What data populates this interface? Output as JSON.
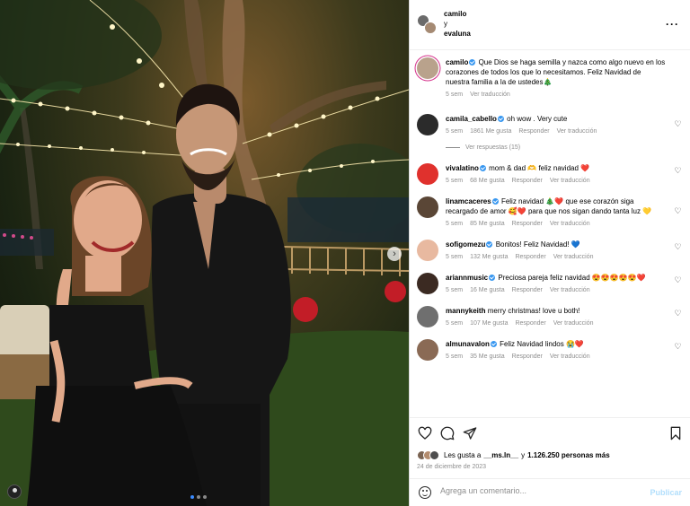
{
  "header": {
    "name1": "camilo",
    "conj": "y",
    "name2": "evaluna",
    "more": "···"
  },
  "caption": {
    "user": "camilo",
    "text": "Que Dios se haga semilla y nazca como algo nuevo en los corazones de todos los que lo necesitamos. Feliz Navidad de nuestra familia a la de ustedes🎄",
    "time": "5 sem",
    "translate": "Ver traducción"
  },
  "comments": [
    {
      "user": "camila_cabello",
      "text": "oh wow . Very cute",
      "time": "5 sem",
      "likes": "1861 Me gusta",
      "reply": "Responder",
      "translate": "Ver traducción",
      "avatar_color": "#2b2b2b"
    },
    {
      "user": "vivalatino",
      "text": "mom & dad 🫶 feliz navidad ❤️",
      "time": "5 sem",
      "likes": "68 Me gusta",
      "reply": "Responder",
      "translate": "Ver traducción",
      "avatar_color": "#e0312d"
    },
    {
      "user": "linamcaceres",
      "text": "Feliz navidad 🎄❤️ que ese corazón siga recargado de amor 🥰❤️ para que nos sigan dando tanta luz 💛",
      "time": "5 sem",
      "likes": "85 Me gusta",
      "reply": "Responder",
      "translate": "Ver traducción",
      "avatar_color": "#5a4636"
    },
    {
      "user": "sofigomezu",
      "text": "Bonitos! Feliz Navidad! 💙",
      "time": "5 sem",
      "likes": "132 Me gusta",
      "reply": "Responder",
      "translate": "Ver traducción",
      "avatar_color": "#e8b9a0"
    },
    {
      "user": "ariannmusic",
      "text": "Preciosa pareja feliz navidad 😍😍😍😍😍❤️",
      "time": "5 sem",
      "likes": "16 Me gusta",
      "reply": "Responder",
      "translate": "Ver traducción",
      "avatar_color": "#3b2a22"
    },
    {
      "user": "mannykeith",
      "text": "merry christmas! love u both!",
      "time": "5 sem",
      "likes": "107 Me gusta",
      "reply": "Responder",
      "translate": "Ver traducción",
      "avatar_color": "#6f6f6f"
    },
    {
      "user": "almunavalon",
      "text": "Feliz Navidad lindos 😭❤️",
      "time": "5 sem",
      "likes": "35 Me gusta",
      "reply": "Responder",
      "translate": "Ver traducción",
      "avatar_color": "#8a6a55"
    }
  ],
  "view_replies": "Ver respuestas (15)",
  "likes": {
    "prefix": "Les gusta a",
    "user": "__ms.ln__",
    "middle": "y",
    "count": "1.126.250 personas más"
  },
  "date": "24 de diciembre de 2023",
  "add_comment": {
    "placeholder": "Agrega un comentario...",
    "post": "Publicar"
  },
  "colors": {
    "verified": "#3897f0",
    "link_disabled": "#b2dffc",
    "muted": "#8e8e8e"
  }
}
